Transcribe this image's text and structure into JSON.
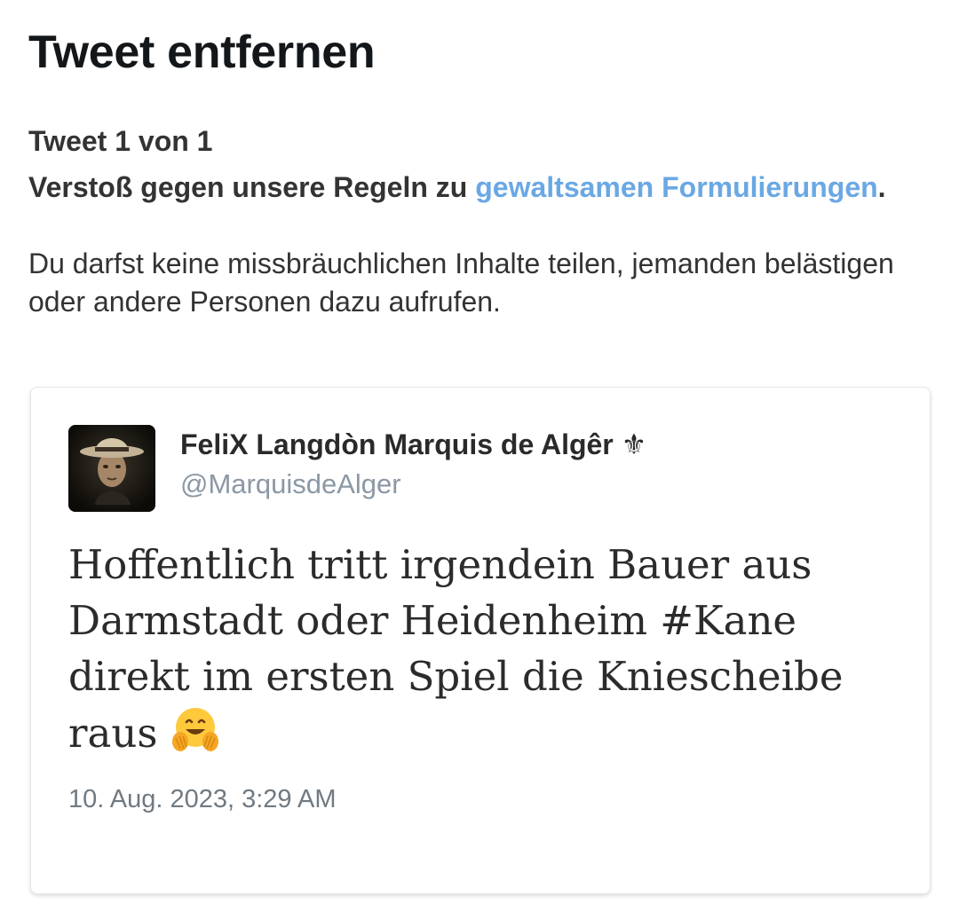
{
  "page": {
    "title": "Tweet entfernen",
    "counter": "Tweet 1 von 1",
    "violation_prefix": "Verstoß gegen unsere Regeln zu ",
    "violation_link": "gewaltsamen Formulierungen",
    "violation_suffix": ".",
    "explanation": "Du darfst keine missbräuchlichen Inhalte teilen, jemanden belästigen oder andere Personen dazu aufrufen."
  },
  "tweet": {
    "display_name": "FeliX Langdòn Marquis de Algêr ⚜",
    "handle": "@MarquisdeAlger",
    "text": "Hoffentlich tritt irgendein Bauer aus Darmstadt oder Heidenheim #Kane direkt im ersten Spiel die Kniescheibe raus",
    "emoji": "hugging-face-emoji",
    "timestamp": "10. Aug. 2023, 3:29 AM"
  },
  "colors": {
    "link": "#6aa8e4",
    "title": "#14171a",
    "body_text": "#333333",
    "handle": "#8b98a5",
    "timestamp": "#707a82",
    "card_border": "#e1e8ed"
  }
}
